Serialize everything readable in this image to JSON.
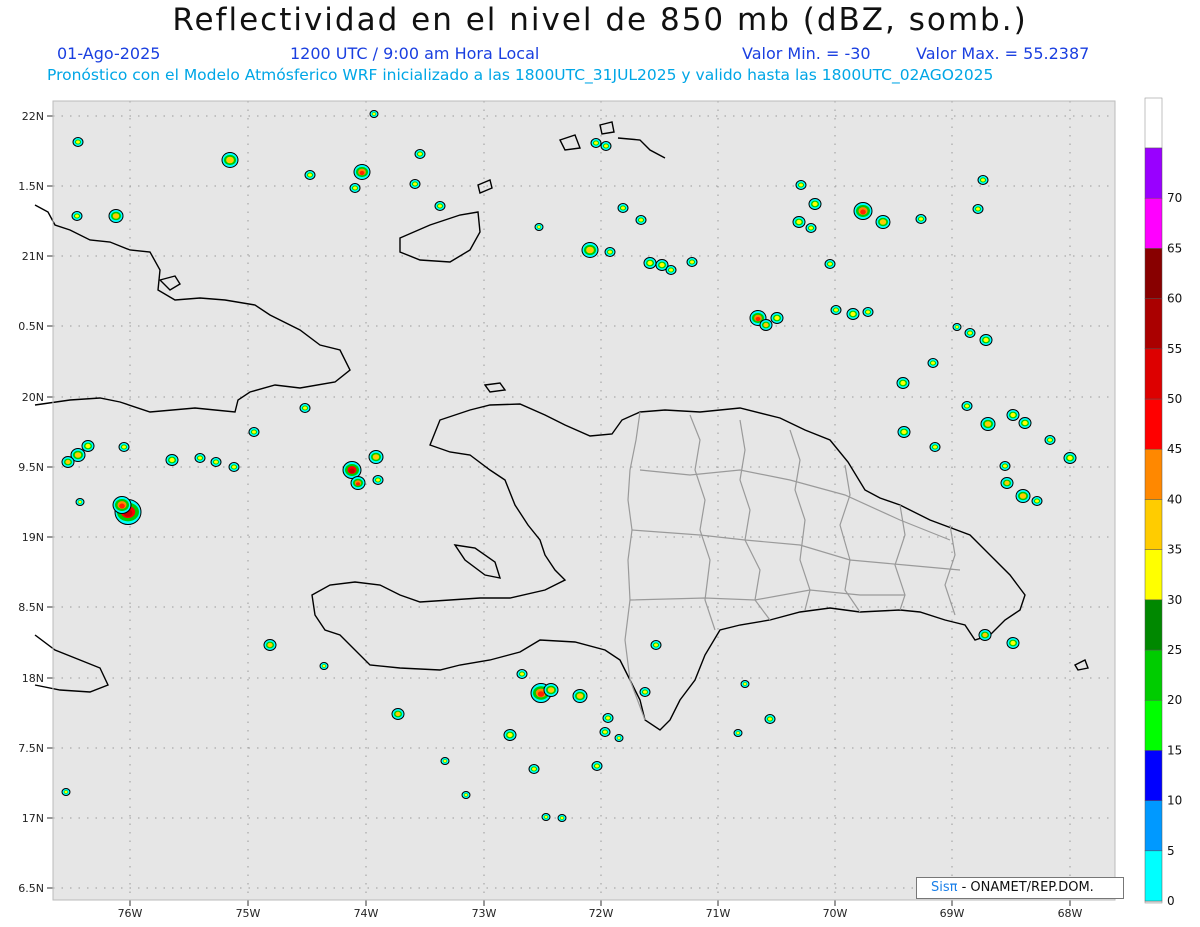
{
  "header": {
    "title": "Reflectividad en el nivel de 850 mb (dBZ, somb.)",
    "date": "01-Ago-2025",
    "time": "1200 UTC / 9:00 am Hora Local",
    "min": "Valor Min. = -30",
    "max": "Valor Max. = 55.2387",
    "model": "Pronóstico con el Modelo Atmósferico WRF inicializado a las 1800UTC_31JUL2025 y valido hasta las  1800UTC_02AGO2025"
  },
  "map": {
    "lon_range": [
      -76.65,
      -67.6
    ],
    "lat_range": [
      16.4,
      22.1
    ],
    "lat_ticks": [
      "22N",
      "1.5N",
      "21N",
      "0.5N",
      "20N",
      "9.5N",
      "19N",
      "8.5N",
      "18N",
      "7.5N",
      "17N",
      "6.5N"
    ],
    "lon_ticks": [
      "76W",
      "75W",
      "74W",
      "73W",
      "72W",
      "71W",
      "70W",
      "69W",
      "68W"
    ],
    "background_color": "#e6e6e6",
    "grid": true
  },
  "colorbar": {
    "labels": [
      "0",
      "5",
      "10",
      "15",
      "20",
      "25",
      "30",
      "35",
      "40",
      "45",
      "50",
      "55",
      "60",
      "65",
      "70"
    ],
    "colors": [
      "#00ffff",
      "#0099ff",
      "#0000ff",
      "#00ff00",
      "#00cc00",
      "#008800",
      "#ffff00",
      "#ffcc00",
      "#ff8800",
      "#ff0000",
      "#dd0000",
      "#aa0000",
      "#880000",
      "#ff00ff",
      "#9900ff"
    ]
  },
  "credit": {
    "sis": "Sisπ",
    "org": "- ONAMET/REP.DOM."
  }
}
